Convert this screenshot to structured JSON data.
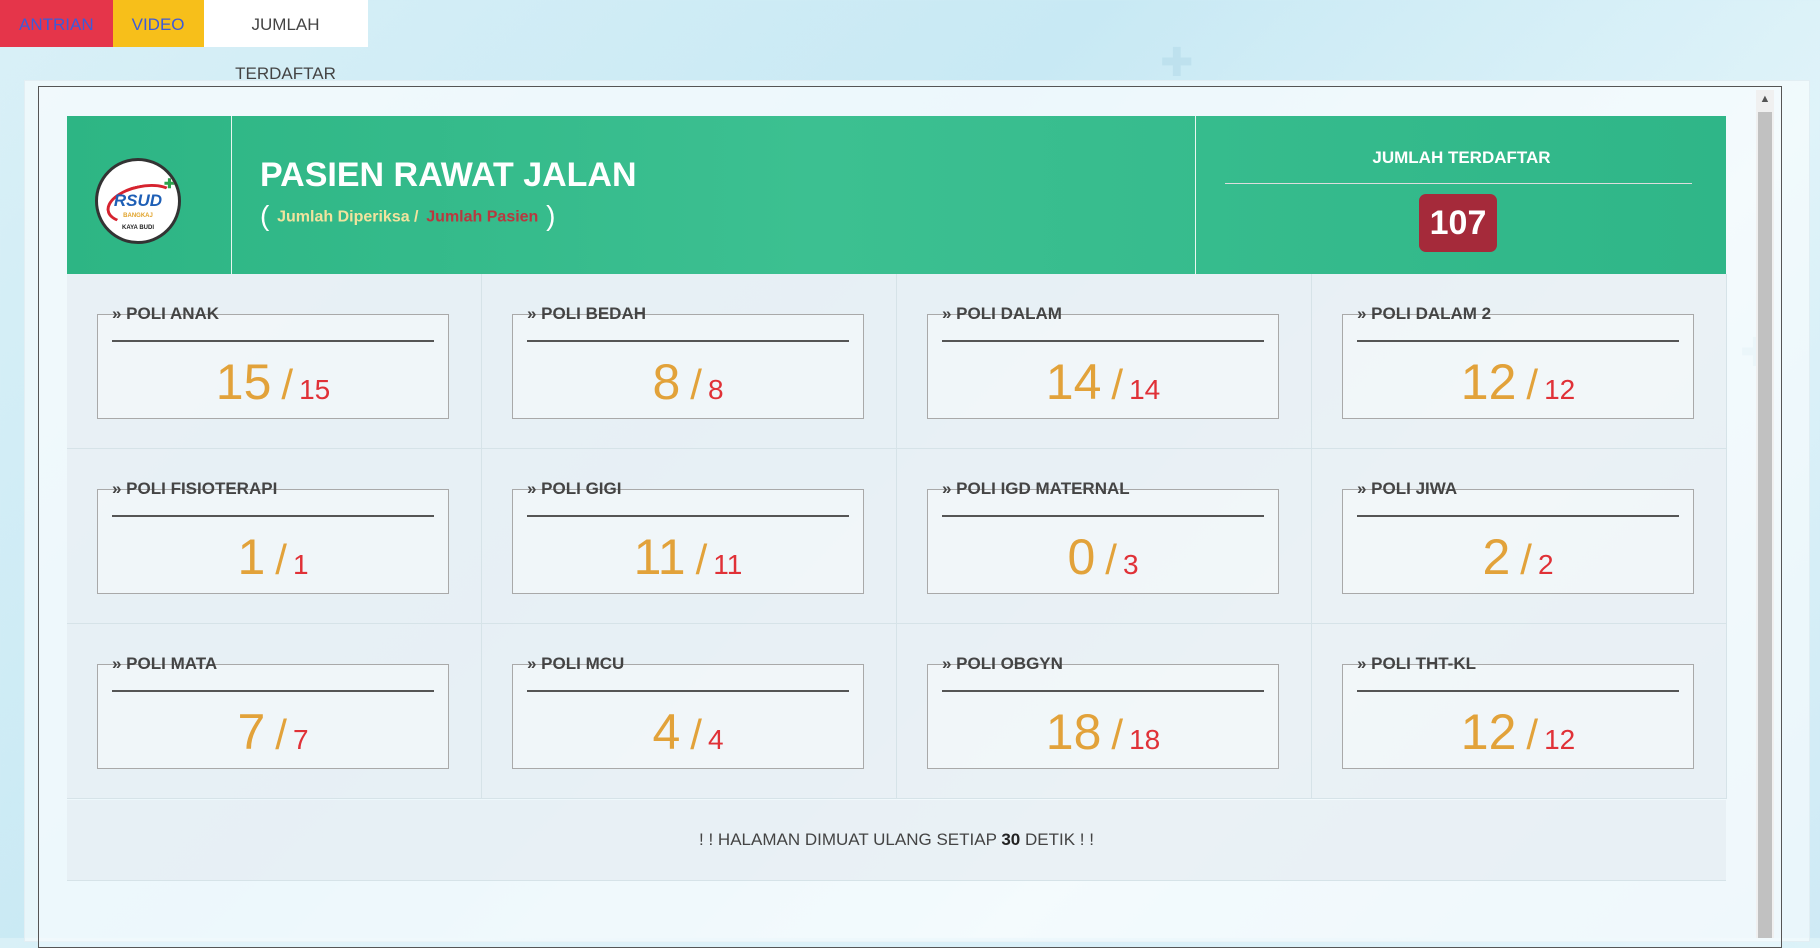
{
  "tabs": [
    {
      "label": "ANTRIAN"
    },
    {
      "label": "VIDEO"
    },
    {
      "label": "JUMLAH TERDAFTAR"
    }
  ],
  "header": {
    "logo_text": "RSUD",
    "logo_sub": "BANGKAJ",
    "logo_bottom": "KAYA BUDI",
    "title": "PASIEN RAWAT JALAN",
    "paren_open": "(",
    "legend_examined": "Jumlah Diperiksa /",
    "legend_patients": "Jumlah Pasien",
    "paren_close": ")",
    "count_label": "JUMLAH TERDAFTAR",
    "count_value": "107"
  },
  "polis": [
    {
      "name": "» POLI ANAK",
      "done": "15",
      "total": "15"
    },
    {
      "name": "» POLI BEDAH",
      "done": "8",
      "total": "8"
    },
    {
      "name": "» POLI DALAM",
      "done": "14",
      "total": "14"
    },
    {
      "name": "» POLI DALAM 2",
      "done": "12",
      "total": "12"
    },
    {
      "name": "» POLI FISIOTERAPI",
      "done": "1",
      "total": "1"
    },
    {
      "name": "» POLI GIGI",
      "done": "11",
      "total": "11"
    },
    {
      "name": "» POLI IGD MATERNAL",
      "done": "0",
      "total": "3"
    },
    {
      "name": "» POLI JIWA",
      "done": "2",
      "total": "2"
    },
    {
      "name": "» POLI MATA",
      "done": "7",
      "total": "7"
    },
    {
      "name": "» POLI MCU",
      "done": "4",
      "total": "4"
    },
    {
      "name": "» POLI OBGYN",
      "done": "18",
      "total": "18"
    },
    {
      "name": "» POLI THT-KL",
      "done": "12",
      "total": "12"
    }
  ],
  "slash": "/",
  "footer": {
    "prefix": "! ! HALAMAN DIMUAT ULANG SETIAP",
    "seconds": "30",
    "suffix": "DETIK ! !"
  },
  "colors": {
    "header_green": "#2db584",
    "badge_red": "#a52a3a",
    "value_orange": "#e2a23a",
    "total_red": "#e03137",
    "tab_antrian": "#e5354a",
    "tab_video": "#f7bf1a"
  }
}
